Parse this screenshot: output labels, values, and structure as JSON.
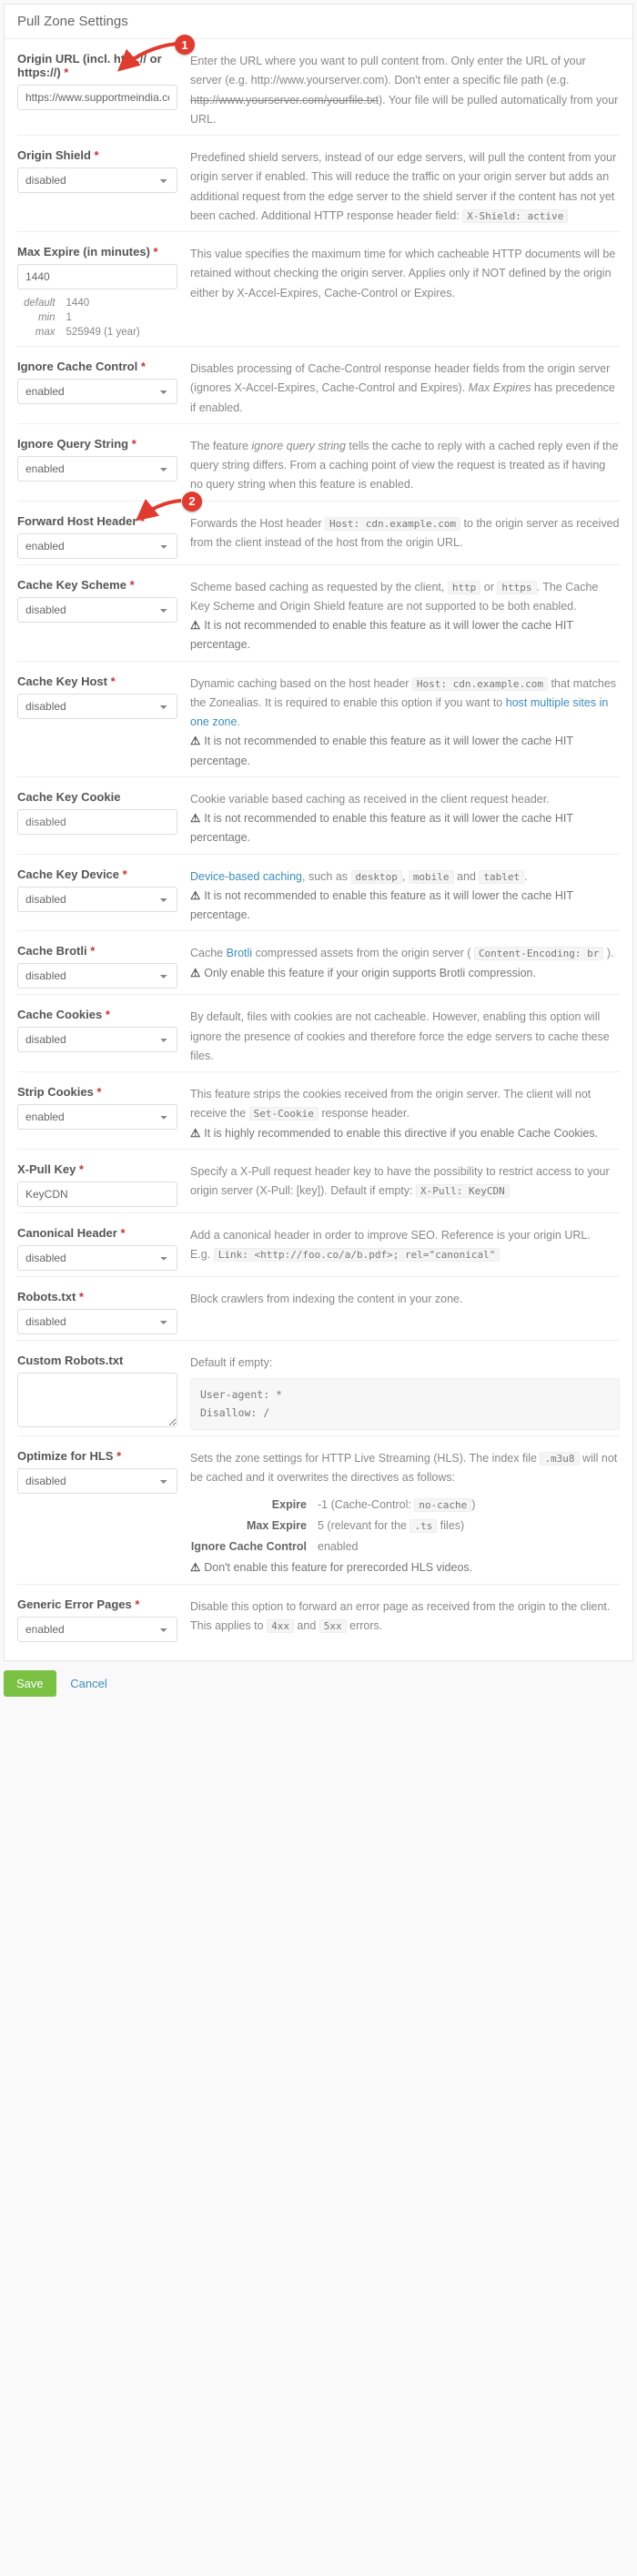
{
  "page": {
    "title": "Pull Zone Settings"
  },
  "annotations": {
    "b1": "1",
    "b2": "2"
  },
  "origin": {
    "label": "Origin URL (incl. http:// or https://)",
    "value": "https://www.supportmeindia.com/",
    "desc_a": "Enter the URL where you want to pull content from. Only enter the URL of your server (e.g. http://www.yourserver.com). Don't enter a specific file path (e.g. ",
    "desc_strike": "http://www.yourserver.com/yourfile.txt",
    "desc_b": "). Your file will be pulled automatically from your URL."
  },
  "shield": {
    "label": "Origin Shield",
    "value": "disabled",
    "desc": "Predefined shield servers, instead of our edge servers, will pull the content from your origin server if enabled. This will reduce the traffic on your origin server but adds an additional request from the edge server to the shield server if the content has not yet been cached. Additional HTTP response header field: ",
    "code": "X-Shield: active"
  },
  "maxexpire": {
    "label": "Max Expire (in minutes)",
    "value": "1440",
    "defaults": {
      "def_l": "default",
      "def_v": "1440",
      "min_l": "min",
      "min_v": "1",
      "max_l": "max",
      "max_v": "525949 (1 year)"
    },
    "desc": "This value specifies the maximum time for which cacheable HTTP documents will be retained without checking the origin server. Applies only if NOT defined by the origin either by X-Accel-Expires, Cache-Control or Expires."
  },
  "ignorecache": {
    "label": "Ignore Cache Control",
    "value": "enabled",
    "desc_a": "Disables processing of Cache-Control response header fields from the origin server (ignores X-Accel-Expires, Cache-Control and Expires). ",
    "desc_em": "Max Expires",
    "desc_b": " has precedence if enabled."
  },
  "ignorequery": {
    "label": "Ignore Query String",
    "value": "enabled",
    "desc_a": "The feature ",
    "desc_em": "ignore query string",
    "desc_b": " tells the cache to reply with a cached reply even if the query string differs. From a caching point of view the request is treated as if having no query string when this feature is enabled."
  },
  "forwardhost": {
    "label": "Forward Host Header",
    "value": "enabled",
    "desc_a": "Forwards the Host header ",
    "code": "Host: cdn.example.com",
    "desc_b": " to the origin server as received from the client instead of the host from the origin URL."
  },
  "keyscheme": {
    "label": "Cache Key Scheme",
    "value": "disabled",
    "desc_a": "Scheme based caching as requested by the client, ",
    "code1": "http",
    "mid": " or ",
    "code2": "https",
    "desc_b": ". The Cache Key Scheme and Origin Shield feature are not supported to be both enabled.",
    "warn": "It is not recommended to enable this feature as it will lower the cache HIT percentage."
  },
  "keyhost": {
    "label": "Cache Key Host",
    "value": "disabled",
    "desc_a": "Dynamic caching based on the host header ",
    "code": "Host: cdn.example.com",
    "desc_b": " that matches the Zonealias. It is required to enable this option if you want to ",
    "link": "host multiple sites in one zone",
    "desc_c": ".",
    "warn": "It is not recommended to enable this feature as it will lower the cache HIT percentage."
  },
  "keycookie": {
    "label": "Cache Key Cookie",
    "value": "disabled",
    "desc": "Cookie variable based caching as received in the client request header.",
    "warn": "It is not recommended to enable this feature as it will lower the cache HIT percentage."
  },
  "keydevice": {
    "label": "Cache Key Device",
    "value": "disabled",
    "link": "Device-based caching",
    "desc_a": ", such as ",
    "c1": "desktop",
    "c2": "mobile",
    "c3": "tablet",
    "and": " and ",
    "comma": ", ",
    "desc_b": ".",
    "warn": "It is not recommended to enable this feature as it will lower the cache HIT percentage."
  },
  "brotli": {
    "label": "Cache Brotli",
    "value": "disabled",
    "desc_a": "Cache ",
    "link": "Brotli",
    "desc_b": " compressed assets from the origin server ( ",
    "code": "Content-Encoding: br",
    "desc_c": " ).",
    "warn": "Only enable this feature if your origin supports Brotli compression."
  },
  "cachecookies": {
    "label": "Cache Cookies",
    "value": "disabled",
    "desc": "By default, files with cookies are not cacheable. However, enabling this option will ignore the presence of cookies and therefore force the edge servers to cache these files."
  },
  "stripcookies": {
    "label": "Strip Cookies",
    "value": "enabled",
    "desc_a": "This feature strips the cookies received from the origin server. The client will not receive the ",
    "code": "Set-Cookie",
    "desc_b": " response header.",
    "warn": "It is highly recommended to enable this directive if you enable Cache Cookies."
  },
  "xpull": {
    "label": "X-Pull Key",
    "value": "KeyCDN",
    "desc": "Specify a X-Pull request header key to have the possibility to restrict access to your origin server (X-Pull: [key]). Default if empty: ",
    "code": "X-Pull: KeyCDN"
  },
  "canonical": {
    "label": "Canonical Header",
    "value": "disabled",
    "desc": "Add a canonical header in order to improve SEO. Reference is your origin URL.",
    "eg_label": "E.g. ",
    "code": "Link: <http://foo.co/a/b.pdf>; rel=\"canonical\""
  },
  "robots": {
    "label": "Robots.txt",
    "value": "disabled",
    "desc": "Block crawlers from indexing the content in your zone."
  },
  "customrobots": {
    "label": "Custom Robots.txt",
    "value": "",
    "desc": "Default if empty:",
    "code": "User-agent: *\nDisallow: /"
  },
  "hls": {
    "label": "Optimize for HLS",
    "value": "disabled",
    "desc_a": "Sets the zone settings for HTTP Live Streaming (HLS). The index file ",
    "code": ".m3u8",
    "desc_b": " will not be cached and it overwrites the directives as follows:",
    "r1k": "Expire",
    "r1v_a": "-1 (Cache-Control: ",
    "r1v_code": "no-cache",
    "r1v_b": ")",
    "r2k": "Max Expire",
    "r2v_a": "5 (relevant for the ",
    "r2v_code": ".ts",
    "r2v_b": " files)",
    "r3k": "Ignore Cache Control",
    "r3v": "enabled",
    "warn": "Don't enable this feature for prerecorded HLS videos."
  },
  "errorpages": {
    "label": "Generic Error Pages",
    "value": "enabled",
    "desc_a": "Disable this option to forward an error page as received from the origin to the client. This applies to ",
    "c1": "4xx",
    "and": " and ",
    "c2": "5xx",
    "desc_b": " errors."
  },
  "footer": {
    "save": "Save",
    "cancel": "Cancel"
  }
}
